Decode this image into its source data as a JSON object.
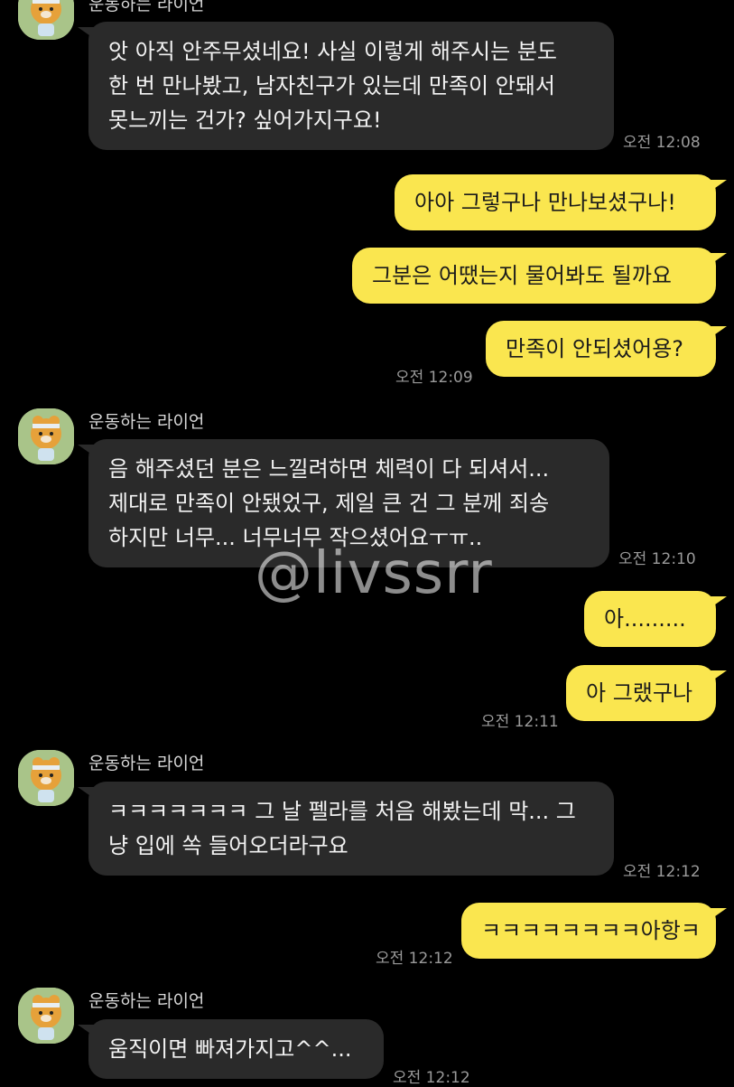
{
  "chat": {
    "sender_name": "운동하는 라이언",
    "avatar_icon": "ryan-character-avatar-icon",
    "colors": {
      "background": "#000000",
      "incoming_bubble": "#2a2a2a",
      "outgoing_bubble": "#fae64f",
      "avatar_bg": "#a9c489"
    },
    "messages": [
      {
        "id": "m1",
        "from": "them",
        "lines": [
          "앗 아직 안주무셨네요! 사실 이렇게 해주시는 분도",
          "한 번 만나봤고, 남자친구가 있는데 만족이 안돼서",
          "못느끼는 건가? 싶어가지구요!"
        ],
        "time": "오전 12:08"
      },
      {
        "id": "m2",
        "from": "me",
        "lines": [
          "아아 그렇구나 만나보셨구나!"
        ]
      },
      {
        "id": "m3",
        "from": "me",
        "lines": [
          "그분은 어땠는지 물어봐도 될까요"
        ]
      },
      {
        "id": "m4",
        "from": "me",
        "lines": [
          "만족이 안되셨어용?"
        ],
        "time": "오전 12:09"
      },
      {
        "id": "m5",
        "from": "them",
        "lines": [
          "음 해주셨던 분은 느낄려하면 체력이 다 되셔서...",
          "제대로 만족이 안됐었구, 제일 큰 건 그 분께 죄송",
          "하지만 너무... 너무너무 작으셨어요ㅜㅠ.."
        ],
        "time": "오전 12:10"
      },
      {
        "id": "m6",
        "from": "me",
        "lines": [
          "아........."
        ]
      },
      {
        "id": "m7",
        "from": "me",
        "lines": [
          "아 그랬구나"
        ],
        "time": "오전 12:11"
      },
      {
        "id": "m8",
        "from": "them",
        "lines": [
          "ㅋㅋㅋㅋㅋㅋㅋ 그 날 펠라를 처음 해봤는데 막... 그",
          "냥 입에 쏙 들어오더라구요"
        ],
        "time": "오전 12:12"
      },
      {
        "id": "m9",
        "from": "me",
        "lines": [
          "ㅋㅋㅋㅋㅋㅋㅋㅋ아항ㅋ"
        ],
        "time": "오전 12:12"
      },
      {
        "id": "m10",
        "from": "them",
        "lines": [
          "움직이면 빠져가지고^^..."
        ],
        "time": "오전 12:12"
      }
    ]
  },
  "watermark": "@livssrr"
}
